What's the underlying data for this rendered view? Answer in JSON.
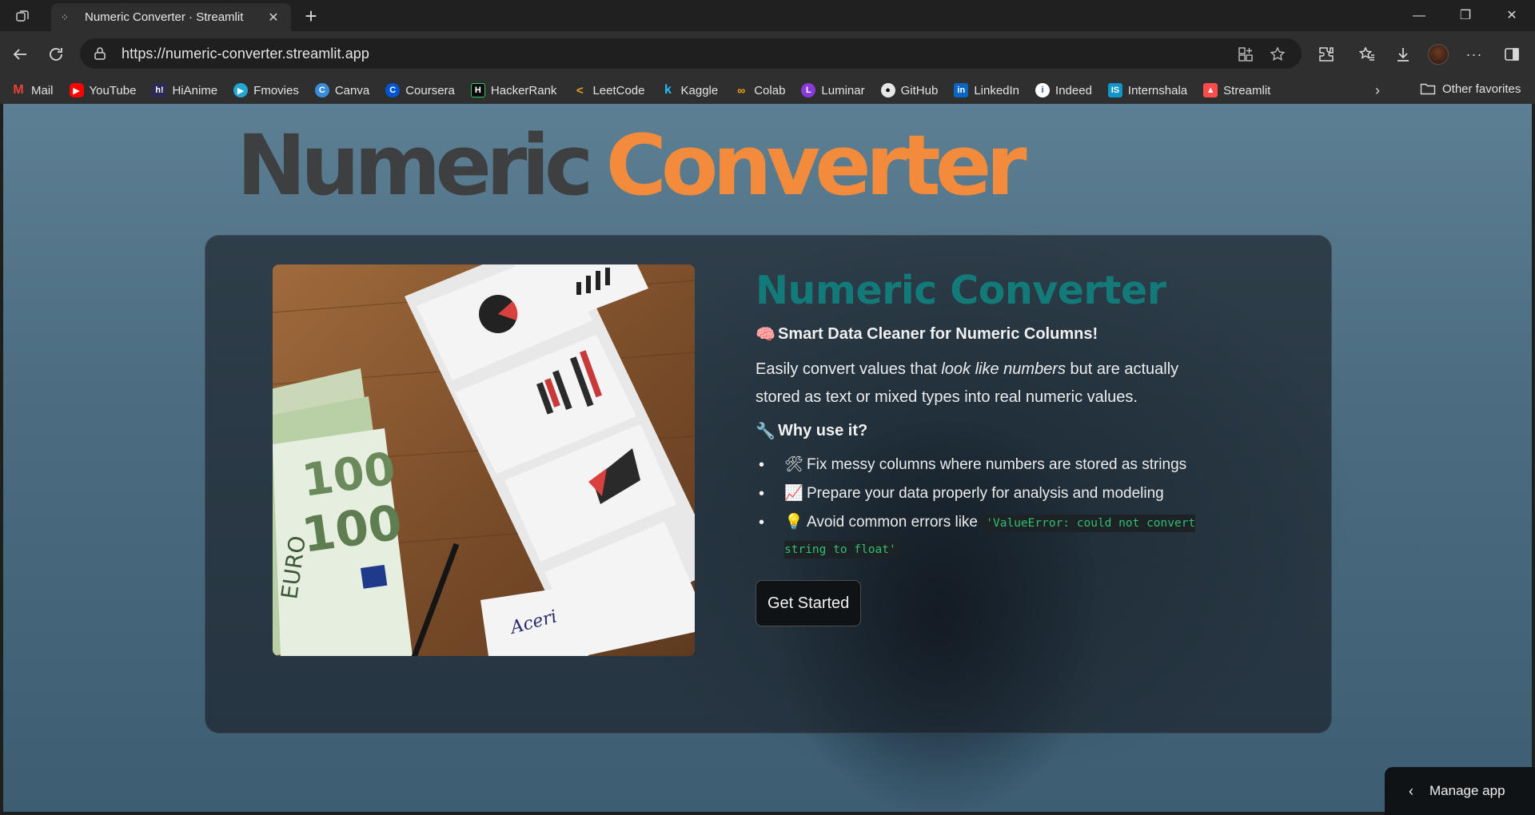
{
  "browser": {
    "tab_title": "Numeric Converter · Streamlit",
    "url": "https://numeric-converter.streamlit.app",
    "bookmarks": [
      "Mail",
      "YouTube",
      "HiAnime",
      "Fmovies",
      "Canva",
      "Coursera",
      "HackerRank",
      "LeetCode",
      "Kaggle",
      "Colab",
      "Luminar",
      "GitHub",
      "LinkedIn",
      "Indeed",
      "Internshala",
      "Streamlit"
    ],
    "other_favorites": "Other favorites"
  },
  "hero": {
    "word1": "Numeric",
    "word2": "Converter"
  },
  "card": {
    "title": "Numeric Converter",
    "tagline_emoji": "🧠",
    "tagline": "Smart Data Cleaner for Numeric Columns!",
    "desc_pre": "Easily convert values that ",
    "desc_em": "look like numbers",
    "desc_post": " but are actually stored as text or mixed types into real numeric values.",
    "why_emoji": "🔧",
    "why": "Why use it?",
    "bullets": [
      {
        "emoji": "🛠",
        "text": "Fix messy columns where numbers are stored as strings"
      },
      {
        "emoji": "📈",
        "text": "Prepare your data properly for analysis and modeling"
      },
      {
        "emoji": "💡",
        "text": "Avoid common errors like ",
        "code": "'ValueError: could not convert string to float'"
      }
    ],
    "button": "Get Started"
  },
  "manage_app": "Manage app",
  "colors": {
    "title_teal": "#137a7a",
    "hero_orange": "#f28b3c",
    "hero_gray": "#3d3f41",
    "code_green": "#2fbf71"
  }
}
